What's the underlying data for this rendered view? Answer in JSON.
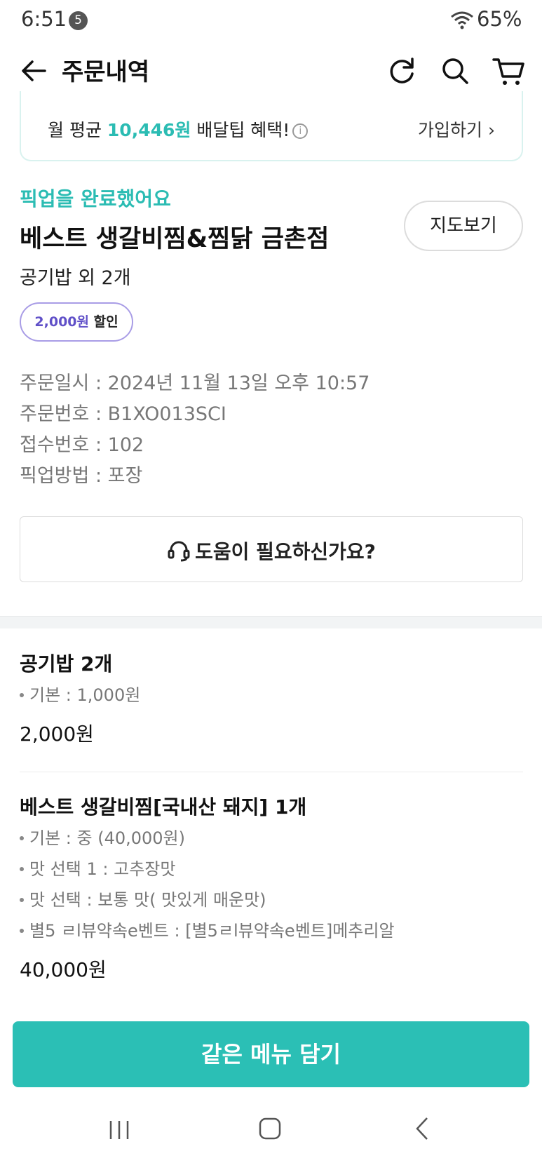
{
  "status_bar": {
    "time": "6:51",
    "notification_count": "5",
    "battery": "65%",
    "icons": [
      "wifi-icon"
    ]
  },
  "app_bar": {
    "title": "주문내역",
    "icons": [
      "back-arrow-icon",
      "refresh-icon",
      "search-icon",
      "cart-icon"
    ]
  },
  "promo": {
    "prefix": "월 평균 ",
    "amount": "10,446원",
    "suffix": " 배달팁 혜택!",
    "info_glyph": "i",
    "join_label": "가입하기 ›"
  },
  "order": {
    "status": "픽업을 완료했어요",
    "store_name": "베스트 생갈비찜&찜닭 금촌점",
    "map_button": "지도보기",
    "summary": "공기밥 외 2개",
    "discount_amount": "2,000원",
    "discount_word": " 할인",
    "meta": [
      {
        "label": "주문일시",
        "value": "2024년 11월 13일 오후 10:57"
      },
      {
        "label": "주문번호",
        "value": "B1XO013SCI"
      },
      {
        "label": "접수번호",
        "value": "102"
      },
      {
        "label": "픽업방법",
        "value": "포장"
      }
    ],
    "meta_separator": " : "
  },
  "help": {
    "label": "도움이 필요하신가요?"
  },
  "items": [
    {
      "name": "공기밥 2개",
      "options": [
        "기본 : 1,000원"
      ],
      "price": "2,000원"
    },
    {
      "name": "베스트 생갈비찜[국내산 돼지] 1개",
      "options": [
        "기본 : 중 (40,000원)",
        "맛 선택 1 : 고추장맛",
        "맛 선택 : 보통 맛( 맛있게 매운맛)",
        "별5 ㄹl뷰약속e벤트 : [별5ㄹl뷰약속e벤트]메추리알"
      ],
      "price": "40,000원"
    }
  ],
  "cta": {
    "label": "같은 메뉴 담기"
  },
  "colors": {
    "accent": "#2bbcb3",
    "discount": "#6050c8",
    "cta_background": "#2bbfb5"
  }
}
